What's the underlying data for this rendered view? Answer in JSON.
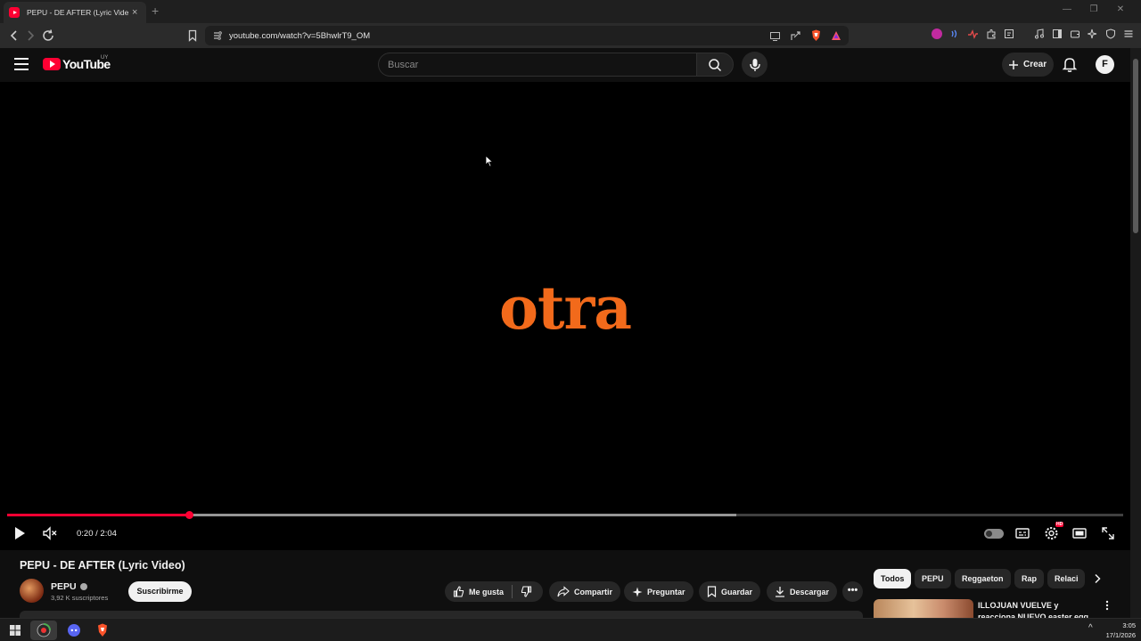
{
  "browser": {
    "tab_title": "PEPU - DE AFTER (Lyric Video) -",
    "tab_close": "×",
    "new_tab": "+",
    "url": "youtube.com/watch?v=5BhwlrT9_OM",
    "window_controls": [
      "—",
      "❐",
      "✕"
    ],
    "shields_count": "47"
  },
  "youtube": {
    "logo_text": "YouTube",
    "country_code": "UY",
    "search_placeholder": "Buscar",
    "create_label": "Crear",
    "avatar_letter": "F"
  },
  "player": {
    "lyric_text": "otra",
    "current_time": "0:20",
    "duration": "2:04",
    "time_display": "0:20 / 2:04",
    "progress_fraction": 0.163,
    "buffered_fraction": 0.653,
    "settings_badge": "HD"
  },
  "video": {
    "title": "PEPU - DE AFTER (Lyric Video)",
    "channel_name": "PEPU",
    "subscribers": "3,92 K suscriptores",
    "subscribe_label": "Suscribirme",
    "actions": {
      "like": "Me gusta",
      "share": "Compartir",
      "ask": "Preguntar",
      "save": "Guardar",
      "download": "Descargar"
    },
    "more_label": "•••"
  },
  "recommendations": {
    "chips": [
      "Todos",
      "PEPU",
      "Reggaeton",
      "Rap",
      "Relaci"
    ],
    "first_title": "ILLOJUAN VUELVE y reacciona NUEVO easter egg en 2026 de"
  },
  "taskbar": {
    "time": "3:05",
    "date": "17/1/2026",
    "tray_arrow": "^"
  },
  "colors": {
    "youtube_red": "#ff0033",
    "lyric_orange": "#f26a1b",
    "background": "#0f0f0f"
  }
}
